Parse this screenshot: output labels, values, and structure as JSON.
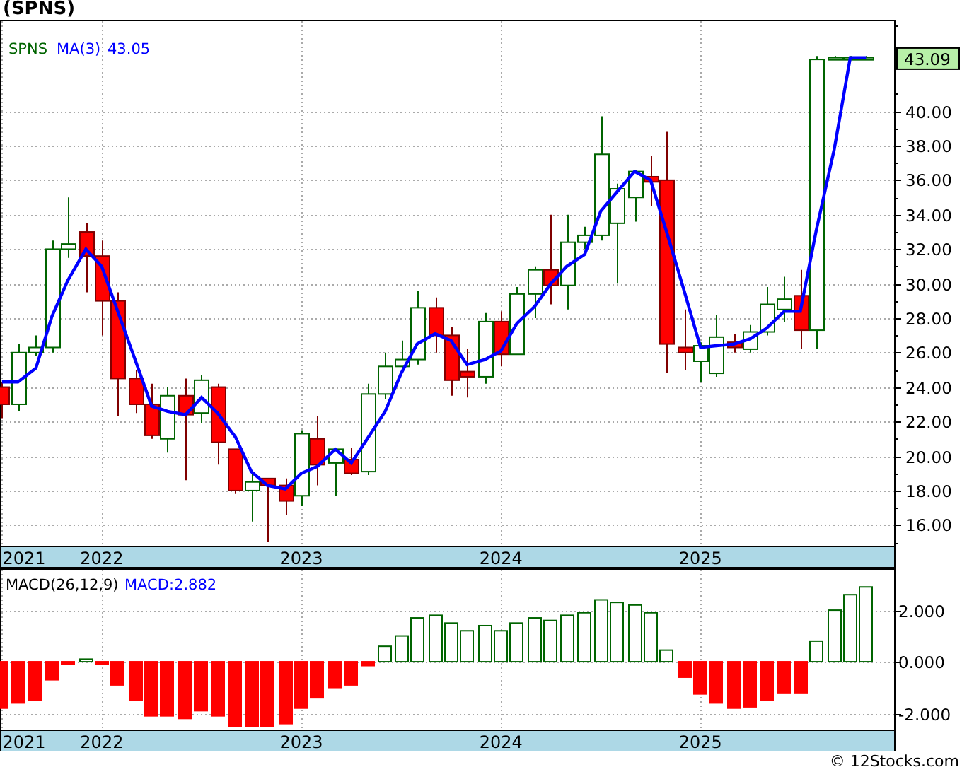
{
  "title": "(SPNS)",
  "price_panel": {
    "symbol": "SPNS",
    "ma_reading": "43.05",
    "last_price": "43.09",
    "chart_data": {
      "type": "candlestick",
      "grid": true,
      "ylim": [
        14.8,
        45.3
      ],
      "xlim": [
        2021.49,
        2025.97
      ],
      "x": [
        2021.5,
        2021.58,
        2021.67,
        2021.75,
        2021.83,
        2021.92,
        2022.0,
        2022.08,
        2022.17,
        2022.25,
        2022.33,
        2022.42,
        2022.5,
        2022.58,
        2022.67,
        2022.75,
        2022.83,
        2022.92,
        2023.0,
        2023.08,
        2023.17,
        2023.25,
        2023.33,
        2023.42,
        2023.5,
        2023.58,
        2023.67,
        2023.75,
        2023.83,
        2023.92,
        2024.0,
        2024.08,
        2024.17,
        2024.25,
        2024.33,
        2024.42,
        2024.5,
        2024.58,
        2024.67,
        2024.75,
        2024.83,
        2024.92,
        2025.0,
        2025.08,
        2025.17,
        2025.25,
        2025.33,
        2025.42,
        2025.5,
        2025.58,
        2025.67,
        2025.75,
        2025.83
      ],
      "xticks": [
        {
          "value": 2021.5,
          "label": "2021"
        },
        {
          "value": 2022,
          "label": "2022"
        },
        {
          "value": 2023,
          "label": "2023"
        },
        {
          "value": 2024,
          "label": "2024"
        },
        {
          "value": 2025,
          "label": "2025"
        }
      ],
      "yticks": [
        {
          "value": 16,
          "label": "16.00"
        },
        {
          "value": 18,
          "label": "18.00"
        },
        {
          "value": 20,
          "label": "20.00"
        },
        {
          "value": 22,
          "label": "22.00"
        },
        {
          "value": 24,
          "label": "24.00"
        },
        {
          "value": 26,
          "label": "26.00"
        },
        {
          "value": 28,
          "label": "28.00"
        },
        {
          "value": 30,
          "label": "30.00"
        },
        {
          "value": 32,
          "label": "32.00"
        },
        {
          "value": 34,
          "label": "34.00"
        },
        {
          "value": 36,
          "label": "36.00"
        },
        {
          "value": 38,
          "label": "38.00"
        },
        {
          "value": 40,
          "label": "40.00"
        }
      ],
      "ohlc": [
        [
          24.0,
          24.3,
          22.2,
          23.0
        ],
        [
          23.0,
          26.5,
          22.6,
          26.0
        ],
        [
          26.0,
          27.0,
          25.8,
          26.3
        ],
        [
          26.3,
          32.5,
          26.0,
          32.0
        ],
        [
          32.0,
          35.0,
          31.5,
          32.3
        ],
        [
          33.0,
          33.5,
          29.5,
          31.6
        ],
        [
          31.6,
          32.5,
          27.0,
          29.0
        ],
        [
          29.0,
          29.5,
          22.3,
          24.5
        ],
        [
          24.5,
          25.0,
          22.5,
          23.0
        ],
        [
          23.0,
          24.2,
          21.0,
          21.2
        ],
        [
          21.0,
          24.0,
          20.2,
          23.5
        ],
        [
          23.5,
          24.5,
          18.6,
          22.4
        ],
        [
          22.5,
          24.7,
          21.9,
          24.4
        ],
        [
          24.0,
          24.2,
          19.5,
          20.8
        ],
        [
          20.4,
          20.4,
          17.8,
          18.0
        ],
        [
          18.0,
          19.0,
          16.2,
          18.5
        ],
        [
          18.7,
          18.7,
          15.0,
          18.3
        ],
        [
          18.3,
          18.7,
          16.6,
          17.4
        ],
        [
          17.7,
          21.5,
          17.1,
          21.3
        ],
        [
          21.0,
          22.3,
          18.3,
          19.5
        ],
        [
          19.6,
          20.5,
          17.7,
          20.4
        ],
        [
          19.8,
          20.5,
          18.9,
          19.0
        ],
        [
          19.1,
          24.2,
          18.9,
          23.6
        ],
        [
          23.6,
          26.0,
          23.3,
          25.2
        ],
        [
          25.2,
          26.7,
          25.0,
          25.6
        ],
        [
          25.6,
          29.6,
          25.3,
          28.6
        ],
        [
          28.6,
          29.2,
          26.0,
          27.0
        ],
        [
          27.0,
          27.5,
          23.5,
          24.4
        ],
        [
          24.9,
          26.2,
          23.4,
          24.6
        ],
        [
          24.6,
          28.3,
          24.2,
          27.8
        ],
        [
          27.8,
          28.4,
          25.2,
          25.9
        ],
        [
          25.9,
          29.8,
          25.9,
          29.4
        ],
        [
          29.4,
          31.0,
          28.0,
          30.8
        ],
        [
          30.8,
          34.0,
          28.8,
          29.9
        ],
        [
          29.9,
          34.0,
          28.5,
          32.4
        ],
        [
          32.4,
          33.3,
          32.0,
          32.8
        ],
        [
          32.8,
          39.7,
          32.5,
          37.5
        ],
        [
          33.5,
          35.8,
          30.0,
          35.5
        ],
        [
          35.0,
          36.6,
          33.6,
          36.5
        ],
        [
          36.2,
          37.4,
          34.5,
          35.9
        ],
        [
          36.0,
          38.8,
          24.8,
          26.5
        ],
        [
          26.3,
          28.5,
          25.0,
          26.0
        ],
        [
          25.5,
          26.6,
          24.3,
          26.4
        ],
        [
          24.8,
          28.2,
          24.6,
          26.9
        ],
        [
          26.6,
          27.1,
          26.0,
          26.3
        ],
        [
          26.2,
          27.6,
          26.0,
          27.2
        ],
        [
          27.2,
          29.8,
          27.0,
          28.8
        ],
        [
          28.5,
          30.4,
          27.8,
          29.1
        ],
        [
          29.3,
          30.8,
          26.2,
          27.3
        ],
        [
          27.3,
          43.2,
          26.2,
          43.0
        ],
        [
          43.0,
          43.2,
          43.0,
          43.1
        ],
        [
          43.1,
          43.2,
          43.0,
          43.1
        ],
        [
          43.1,
          43.2,
          43.1,
          43.1
        ]
      ],
      "series": [
        {
          "name": "MA(3)",
          "type": "line",
          "color": "#0000ff",
          "values": [
            24.3,
            24.3,
            25.1,
            28.1,
            30.2,
            32.0,
            31.0,
            28.4,
            25.5,
            22.9,
            22.6,
            22.4,
            23.4,
            22.5,
            21.1,
            19.1,
            18.3,
            18.1,
            19.0,
            19.4,
            20.4,
            19.6,
            21.0,
            22.6,
            24.8,
            26.5,
            27.1,
            26.7,
            25.3,
            25.6,
            26.1,
            27.7,
            28.7,
            30.0,
            31.0,
            31.7,
            34.2,
            35.3,
            36.5,
            36.0,
            33.0,
            29.5,
            26.3,
            26.4,
            26.5,
            26.8,
            27.4,
            28.4,
            28.4,
            33.1,
            37.8,
            43.1,
            43.1
          ]
        }
      ]
    }
  },
  "macd_panel": {
    "reading": "MACD:2.882",
    "chart_data": {
      "type": "bar",
      "grid": true,
      "ylim": [
        -2.63,
        3.62
      ],
      "xlim": [
        2021.49,
        2025.97
      ],
      "x": [
        2021.5,
        2021.58,
        2021.67,
        2021.75,
        2021.83,
        2021.92,
        2022.0,
        2022.08,
        2022.17,
        2022.25,
        2022.33,
        2022.42,
        2022.5,
        2022.58,
        2022.67,
        2022.75,
        2022.83,
        2022.92,
        2023.0,
        2023.08,
        2023.17,
        2023.25,
        2023.33,
        2023.42,
        2023.5,
        2023.58,
        2023.67,
        2023.75,
        2023.83,
        2023.92,
        2024.0,
        2024.08,
        2024.17,
        2024.25,
        2024.33,
        2024.42,
        2024.5,
        2024.58,
        2024.67,
        2024.75,
        2024.83,
        2024.92,
        2025.0,
        2025.08,
        2025.17,
        2025.25,
        2025.33,
        2025.42,
        2025.5,
        2025.58,
        2025.67,
        2025.75,
        2025.83
      ],
      "xticks": [
        {
          "value": 2021.5,
          "label": "2021"
        },
        {
          "value": 2022,
          "label": "2022"
        },
        {
          "value": 2023,
          "label": "2023"
        },
        {
          "value": 2024,
          "label": "2024"
        },
        {
          "value": 2025,
          "label": "2025"
        }
      ],
      "yticks": [
        {
          "value": -2,
          "label": "-2.000"
        },
        {
          "value": 0,
          "label": "0.000"
        },
        {
          "value": 2,
          "label": "2.000"
        }
      ],
      "series": [
        {
          "name": "MACD(26,12,9)",
          "values": [
            -1.8,
            -1.6,
            -1.5,
            -0.7,
            -0.1,
            0.1,
            -0.1,
            -0.9,
            -1.5,
            -2.1,
            -2.1,
            -2.2,
            -1.9,
            -2.1,
            -2.5,
            -2.5,
            -2.5,
            -2.4,
            -1.8,
            -1.4,
            -1.0,
            -0.9,
            -0.15,
            0.6,
            1.0,
            1.7,
            1.8,
            1.5,
            1.2,
            1.4,
            1.2,
            1.5,
            1.7,
            1.6,
            1.8,
            1.9,
            2.4,
            2.3,
            2.2,
            1.9,
            0.45,
            -0.6,
            -1.25,
            -1.6,
            -1.8,
            -1.75,
            -1.5,
            -1.2,
            -1.2,
            0.8,
            2.0,
            2.6,
            2.9
          ]
        }
      ]
    }
  },
  "credit": "© 12Stocks.com"
}
